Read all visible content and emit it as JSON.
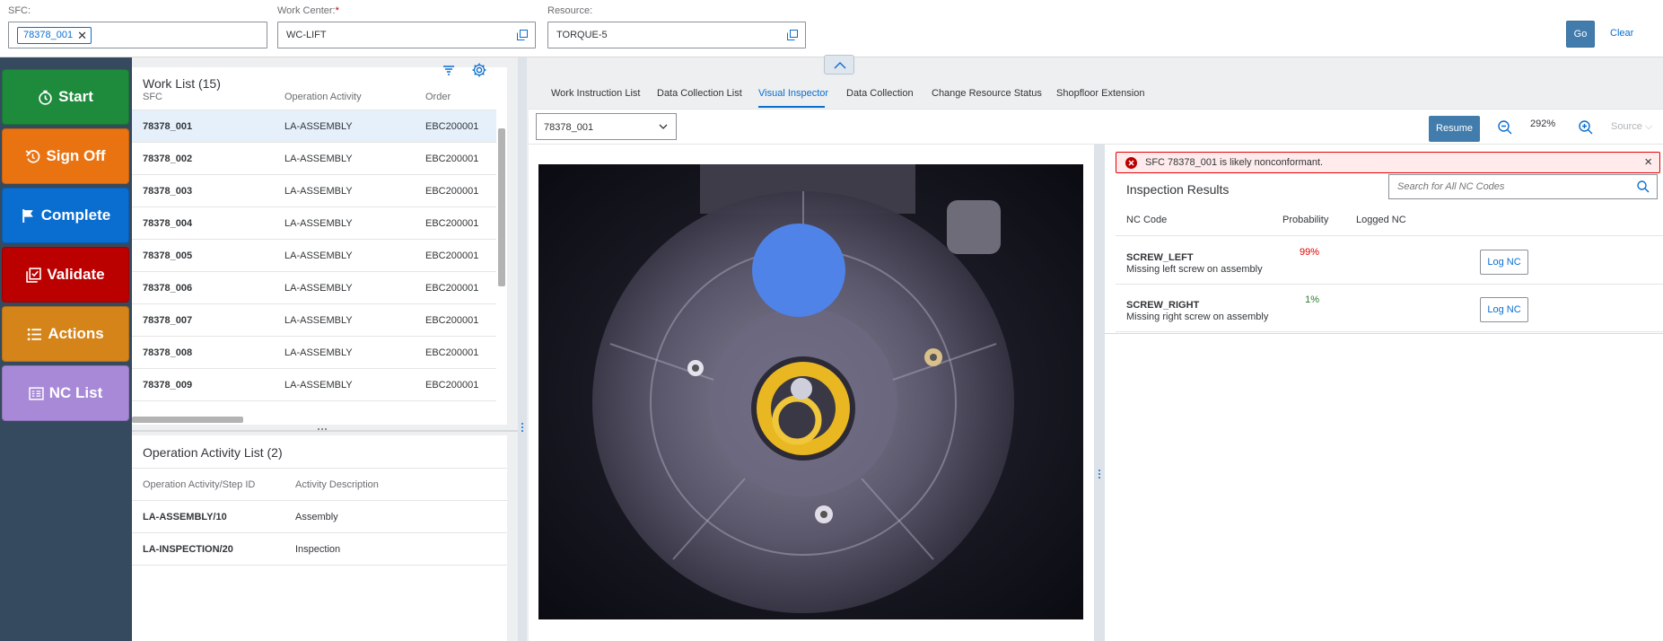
{
  "filters": {
    "sfc_label": "SFC:",
    "sfc_token": "78378_001",
    "workcenter_label": "Work Center:",
    "workcenter_required": "*",
    "workcenter_value": "WC-LIFT",
    "resource_label": "Resource:",
    "resource_value": "TORQUE-5",
    "go_label": "Go",
    "clear_label": "Clear"
  },
  "actions": [
    {
      "label": "Start",
      "color": "#1e8a3c",
      "icon": "clock-icon"
    },
    {
      "label": "Sign Off",
      "color": "#ea7311",
      "icon": "undo-icon"
    },
    {
      "label": "Complete",
      "color": "#0a6ed1",
      "icon": "flag-icon"
    },
    {
      "label": "Validate",
      "color": "#bb0000",
      "icon": "validate-icon"
    },
    {
      "label": "Actions",
      "color": "#d5841a",
      "icon": "list-icon"
    },
    {
      "label": "NC List",
      "color": "#a889d7",
      "icon": "nc-list-icon"
    }
  ],
  "worklist": {
    "title": "Work List (15)",
    "columns": [
      "SFC",
      "Operation Activity",
      "Order"
    ],
    "rows": [
      {
        "sfc": "78378_001",
        "op": "LA-ASSEMBLY",
        "order": "EBC200001"
      },
      {
        "sfc": "78378_002",
        "op": "LA-ASSEMBLY",
        "order": "EBC200001"
      },
      {
        "sfc": "78378_003",
        "op": "LA-ASSEMBLY",
        "order": "EBC200001"
      },
      {
        "sfc": "78378_004",
        "op": "LA-ASSEMBLY",
        "order": "EBC200001"
      },
      {
        "sfc": "78378_005",
        "op": "LA-ASSEMBLY",
        "order": "EBC200001"
      },
      {
        "sfc": "78378_006",
        "op": "LA-ASSEMBLY",
        "order": "EBC200001"
      },
      {
        "sfc": "78378_007",
        "op": "LA-ASSEMBLY",
        "order": "EBC200001"
      },
      {
        "sfc": "78378_008",
        "op": "LA-ASSEMBLY",
        "order": "EBC200001"
      },
      {
        "sfc": "78378_009",
        "op": "LA-ASSEMBLY",
        "order": "EBC200001"
      }
    ],
    "selected_index": 0
  },
  "oplist": {
    "title": "Operation Activity List (2)",
    "columns": [
      "Operation Activity/Step ID",
      "Activity Description"
    ],
    "rows": [
      {
        "id": "LA-ASSEMBLY/10",
        "desc": "Assembly"
      },
      {
        "id": "LA-INSPECTION/20",
        "desc": "Inspection"
      }
    ]
  },
  "tabs": [
    {
      "label": "Work Instruction List",
      "active": false
    },
    {
      "label": "Data Collection List",
      "active": false
    },
    {
      "label": "Visual Inspector",
      "active": true
    },
    {
      "label": "Data Collection",
      "active": false
    },
    {
      "label": "Change Resource Status",
      "active": false
    },
    {
      "label": "Shopfloor Extension",
      "active": false
    }
  ],
  "viewer": {
    "sfc_selected": "78378_001",
    "resume_label": "Resume",
    "zoom": "292%",
    "source_label": "Source"
  },
  "results": {
    "message": "SFC 78378_001 is likely nonconformant.",
    "title": "Inspection Results",
    "search_placeholder": "Search for All NC Codes",
    "columns": [
      "NC Code",
      "Probability",
      "Logged NC"
    ],
    "rows": [
      {
        "code": "SCREW_LEFT",
        "desc": "Missing left screw on assembly",
        "prob": "99%",
        "prob_color": "#e00000",
        "button": "Log NC"
      },
      {
        "code": "SCREW_RIGHT",
        "desc": "Missing right screw on assembly",
        "prob": "1%",
        "prob_color": "#2b7d2b",
        "button": "Log NC"
      }
    ]
  },
  "colors": {
    "shell_dark": "#354a5f",
    "accent": "#0a6ed1",
    "primary_button": "#427cac",
    "error": "#bb0000"
  }
}
